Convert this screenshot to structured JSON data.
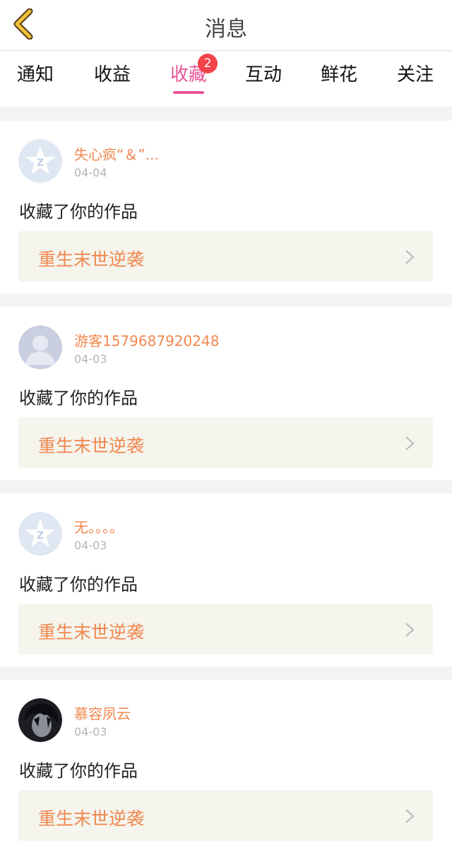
{
  "header": {
    "title": "消息",
    "back_icon": "chevron-left-icon"
  },
  "tabs": [
    {
      "label": "通知"
    },
    {
      "label": "收益"
    },
    {
      "label": "收藏",
      "active": true,
      "badge": "2"
    },
    {
      "label": "互动"
    },
    {
      "label": "鲜花"
    },
    {
      "label": "关注"
    }
  ],
  "colors": {
    "accent": "#e8559a",
    "badge": "#f3434b",
    "name": "#f0884f",
    "card_bg": "#f5f4ed"
  },
  "messages": [
    {
      "user": "失心疯“＆”...",
      "date": "04-04",
      "avatar": "default-star-avatar",
      "action": "收藏了你的作品",
      "work": "重生末世逆袭"
    },
    {
      "user": "游客1579687920248",
      "date": "04-03",
      "avatar": "default-person-avatar",
      "action": "收藏了你的作品",
      "work": "重生末世逆袭"
    },
    {
      "user": "无。。。。",
      "date": "04-03",
      "avatar": "default-star-avatar",
      "action": "收藏了你的作品",
      "work": "重生末世逆袭"
    },
    {
      "user": "慕容夙云",
      "date": "04-03",
      "avatar": "photo-avatar",
      "action": "收藏了你的作品",
      "work": "重生末世逆袭"
    }
  ]
}
